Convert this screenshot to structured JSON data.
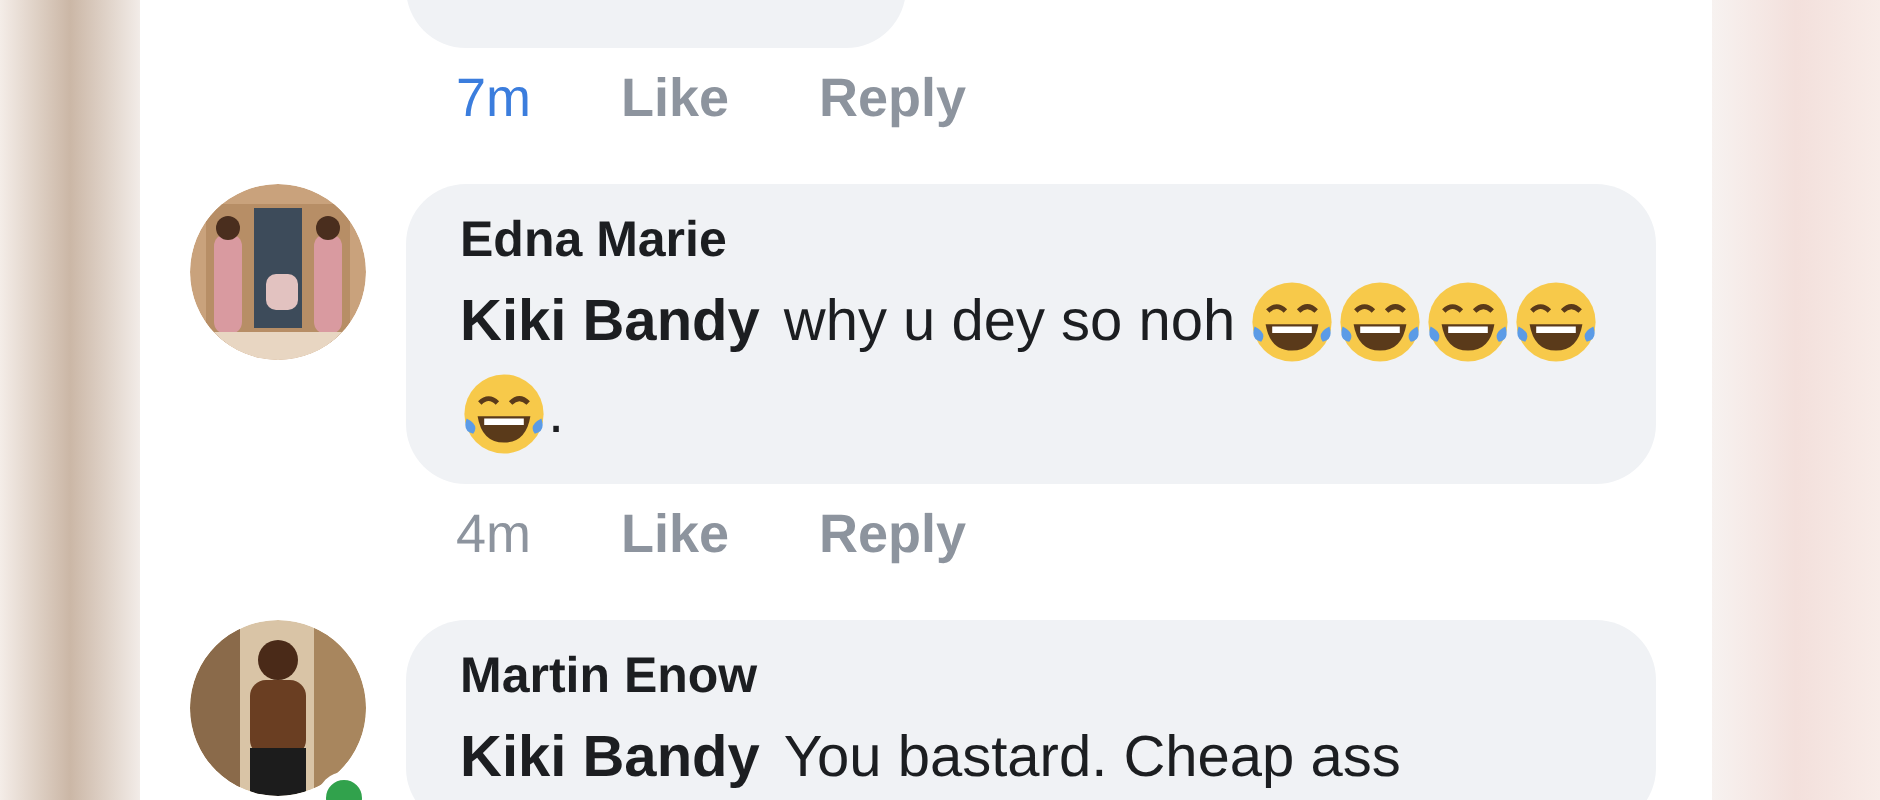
{
  "comments": [
    {
      "time": "7m",
      "time_new": true,
      "actions": [
        "Like",
        "Reply"
      ]
    },
    {
      "author": "Edna Marie",
      "segments": [
        {
          "kind": "mention",
          "text": "Kiki Bandy"
        },
        {
          "kind": "text",
          "text": "why u dey so noh"
        },
        {
          "kind": "emoji"
        },
        {
          "kind": "emoji"
        },
        {
          "kind": "emoji"
        },
        {
          "kind": "emoji"
        },
        {
          "kind": "emoji"
        },
        {
          "kind": "text",
          "text": "."
        }
      ],
      "time": "4m",
      "time_new": false,
      "actions": [
        "Like",
        "Reply"
      ]
    },
    {
      "author": "Martin Enow",
      "online": true,
      "segments": [
        {
          "kind": "mention",
          "text": "Kiki Bandy"
        },
        {
          "kind": "text",
          "text": "You bastard. Cheap ass"
        }
      ]
    }
  ]
}
